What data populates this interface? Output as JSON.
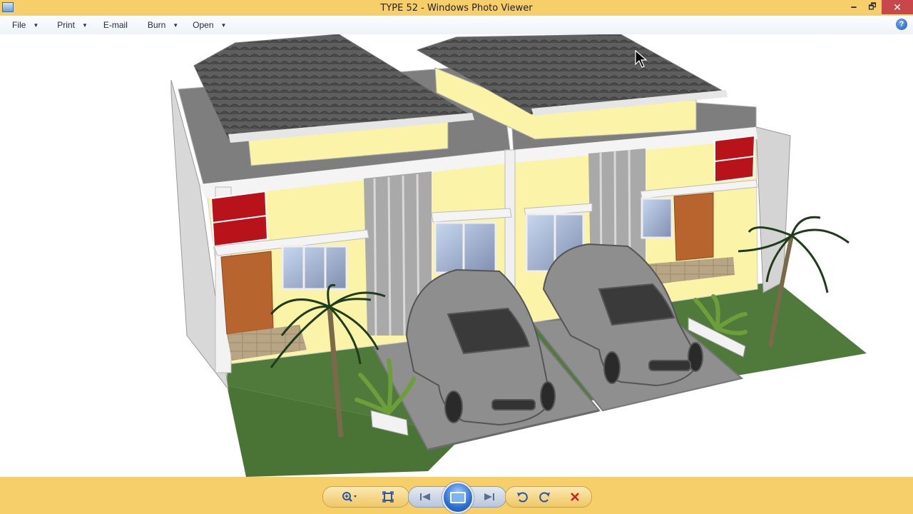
{
  "window": {
    "title": "TYPE 52 - Windows Photo Viewer",
    "controls": {
      "minimize": "🗕",
      "maximize": "🗗",
      "close": "✕"
    }
  },
  "menu": [
    {
      "label": "File",
      "has_dropdown": true
    },
    {
      "label": "Print",
      "has_dropdown": true
    },
    {
      "label": "E-mail",
      "has_dropdown": false
    },
    {
      "label": "Burn",
      "has_dropdown": true
    },
    {
      "label": "Open",
      "has_dropdown": true
    }
  ],
  "help_label": "?",
  "toolbar": {
    "zoom_icon": "magnifier-icon",
    "actual_size_icon": "actual-size-icon",
    "previous_icon": "previous-icon",
    "slideshow_icon": "slideshow-icon",
    "next_icon": "next-icon",
    "rotate_ccw_icon": "rotate-counterclockwise-icon",
    "rotate_cw_icon": "rotate-clockwise-icon",
    "delete_icon": "delete-icon"
  },
  "colors": {
    "chrome": "#f6cf6a",
    "wall_yellow": "#fbf3a8",
    "roof": "#5a5a5a",
    "accent_red": "#b8121b",
    "grass": "#4f7a3b",
    "car": "#8e8e8e",
    "delete_red": "#cc2222"
  }
}
